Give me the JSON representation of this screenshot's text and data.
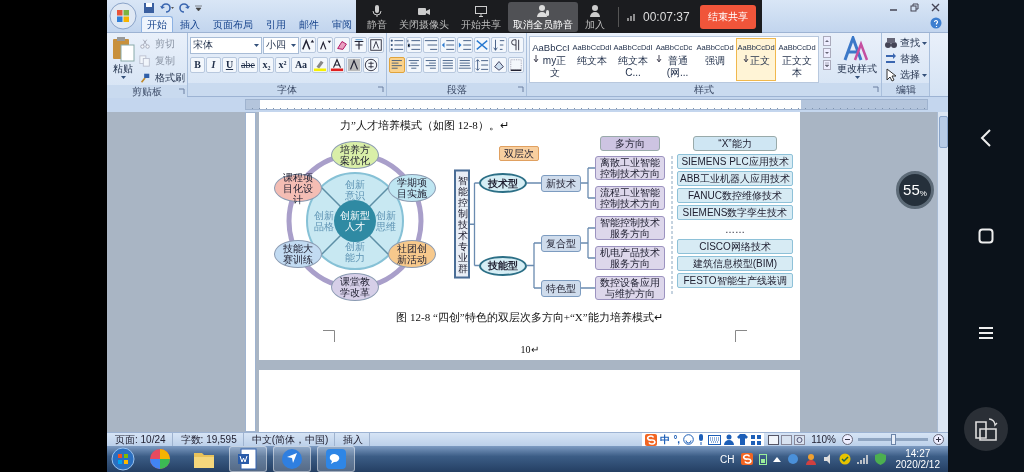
{
  "meeting_bar": {
    "buttons": [
      {
        "label": "静音",
        "kind": "mic",
        "selected": false
      },
      {
        "label": "关闭摄像头",
        "kind": "camera",
        "selected": false
      },
      {
        "label": "开始共享",
        "kind": "screen",
        "selected": false
      },
      {
        "label": "取消全员静音",
        "kind": "mute_all",
        "selected": true
      },
      {
        "label": "加入",
        "kind": "person",
        "selected": false
      }
    ],
    "timer": "00:07:37",
    "end_button": "结束共享"
  },
  "word": {
    "tabs": [
      {
        "label": "开始",
        "selected": true
      },
      {
        "label": "插入",
        "selected": false
      },
      {
        "label": "页面布局",
        "selected": false
      },
      {
        "label": "引用",
        "selected": false
      },
      {
        "label": "邮件",
        "selected": false
      },
      {
        "label": "审阅",
        "selected": false
      }
    ],
    "clipboard": {
      "paste": "粘贴",
      "tools": [
        {
          "label": "剪切",
          "kind": "cut",
          "disabled": true
        },
        {
          "label": "复制",
          "kind": "copy",
          "disabled": true
        },
        {
          "label": "格式刷",
          "kind": "brush",
          "disabled": false
        }
      ],
      "group": "剪贴板"
    },
    "font": {
      "name": "宋体",
      "size": "小四",
      "format_buttons": [
        {
          "label": "B",
          "kind": "bold"
        },
        {
          "label": "I",
          "kind": "italic"
        },
        {
          "label": "U",
          "kind": "underline"
        },
        {
          "label": "abe",
          "kind": "strike"
        },
        {
          "label": "x₂",
          "kind": "sub"
        },
        {
          "label": "x²",
          "kind": "sup"
        },
        {
          "label": "Aa",
          "kind": "case"
        }
      ],
      "group": "字体"
    },
    "paragraph": {
      "alignments": [
        {
          "kind": "left",
          "selected": true
        },
        {
          "kind": "center",
          "selected": false
        },
        {
          "kind": "right",
          "selected": false
        },
        {
          "kind": "justify",
          "selected": false
        },
        {
          "kind": "distributed",
          "selected": false
        }
      ],
      "group": "段落"
    },
    "styles": {
      "items": [
        {
          "sample": "AaBbCcI",
          "name": "my正文",
          "kind": "paragraph",
          "selected": false
        },
        {
          "sample": "AaBbCcDdI",
          "name": "纯文本",
          "kind": "character",
          "selected": false
        },
        {
          "sample": "AaBbCcDdI",
          "name": "纯文本 C...",
          "kind": "character",
          "selected": false
        },
        {
          "sample": "AaBbCcDc",
          "name": "普通(网...",
          "kind": "paragraph",
          "selected": false
        },
        {
          "sample": "AaBbCcDd",
          "name": "强调",
          "kind": "character",
          "selected": false
        },
        {
          "sample": "AaBbCcDd",
          "name": "正文",
          "kind": "paragraph",
          "selected": true
        },
        {
          "sample": "AaBbCcDd",
          "name": "正文文本",
          "kind": "character",
          "selected": false
        }
      ],
      "change_styles": "更改样式",
      "group": "样式"
    },
    "editing": {
      "tools": [
        {
          "label": "查找",
          "kind": "find"
        },
        {
          "label": "替换",
          "kind": "replace"
        },
        {
          "label": "选择",
          "kind": "select"
        }
      ],
      "group": "编辑"
    }
  },
  "document": {
    "text": "力”人才培养模式（如图 12-8）。↵",
    "figure": {
      "wheel": {
        "center": "创新型人才",
        "quadrants": [
          "创新意识",
          "创新思维",
          "创新能力",
          "创新品格"
        ],
        "nodes": [
          {
            "label": "培养方案优化",
            "color": "#d9efa8"
          },
          {
            "label": "课程项目化设计",
            "color": "#f4bdb4"
          },
          {
            "label": "学期项目实施",
            "color": "#bfe6f2"
          },
          {
            "label": "技能大赛训练",
            "color": "#c2dbf2"
          },
          {
            "label": "社团创新活动",
            "color": "#f7c98c"
          },
          {
            "label": "课堂教学改革",
            "color": "#d6cfe8"
          }
        ]
      },
      "tree": {
        "title": "智能控制技术专业群",
        "level_label": "双层次",
        "directions_header": "多方向",
        "abilities_header": "“X”能力",
        "types": [
          {
            "label": "技术型",
            "branches": [
              {
                "label": "新技术",
                "directions": [
                  "离散工业智能控制技术方向",
                  "流程工业智能控制技术方向"
                ]
              }
            ]
          },
          {
            "label": "技能型",
            "branches": [
              {
                "label": "复合型",
                "directions": [
                  "智能控制技术服务方向",
                  "机电产品技术服务方向"
                ]
              },
              {
                "label": "特色型",
                "directions": [
                  "数控设备应用与维护方向"
                ]
              }
            ]
          }
        ],
        "abilities": [
          {
            "label": "SIEMENS PLC应用技术",
            "kind": "box"
          },
          {
            "label": "ABB工业机器人应用技术",
            "kind": "box"
          },
          {
            "label": "FANUC数控维修技术",
            "kind": "box"
          },
          {
            "label": "SIEMENS数字孪生技术",
            "kind": "box"
          },
          {
            "label": "……",
            "kind": "ellipsis"
          },
          {
            "label": "CISCO网络技术",
            "kind": "box"
          },
          {
            "label": "建筑信息模型(BIM)",
            "kind": "box"
          },
          {
            "label": "FESTO智能生产线装调",
            "kind": "box"
          }
        ]
      }
    },
    "caption": "图 12-8 “四创”特色的双层次多方向+“X”能力培养模式↵",
    "page_number": "10↵"
  },
  "status_bar": {
    "items": [
      "页面: 10/24",
      "字数: 19,595",
      "中文(简体，中国)",
      "插入"
    ],
    "ime": [
      "中",
      "°,"
    ],
    "zoom": "110%",
    "zoom_slider": {
      "level": 0.5
    }
  },
  "taskbar": {
    "apps": [
      {
        "kind": "colorwheel",
        "running": false
      },
      {
        "kind": "folder",
        "running": false
      },
      {
        "kind": "word",
        "running": true
      },
      {
        "kind": "pin",
        "running": true
      },
      {
        "kind": "chat",
        "running": true
      }
    ],
    "language": "CH",
    "time": "14:27",
    "date": "2020/2/12"
  },
  "overlay_badge": "55$_{%}$"
}
